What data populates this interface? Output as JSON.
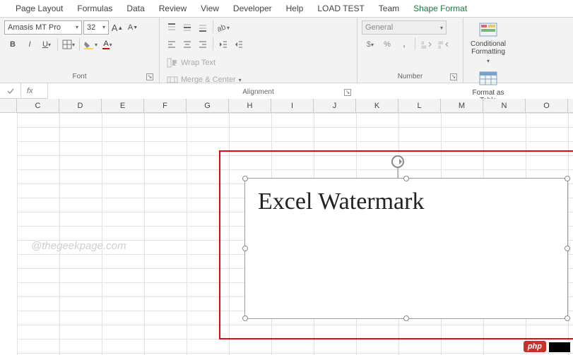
{
  "tabs": {
    "items": [
      "Page Layout",
      "Formulas",
      "Data",
      "Review",
      "View",
      "Developer",
      "Help",
      "LOAD TEST",
      "Team",
      "Shape Format"
    ],
    "active_index": 9
  },
  "ribbon": {
    "font": {
      "group_label": "Font",
      "font_name": "Amasis MT Pro",
      "font_size": "32",
      "grow_label": "A▲",
      "shrink_label": "A▼",
      "bold": "B",
      "italic": "I",
      "underline": "U",
      "fill_hint": "ab",
      "color_hint": "A"
    },
    "alignment": {
      "group_label": "Alignment",
      "wrap_label": "Wrap Text",
      "merge_label": "Merge & Center"
    },
    "number": {
      "group_label": "Number",
      "format": "General",
      "currency": "$",
      "percent": "%",
      "comma": ",",
      "inc": ".0→.00",
      "dec": ".00→.0"
    },
    "styles": {
      "cond_label": "Conditional Formatting",
      "table_label": "Format as Table"
    }
  },
  "formula_bar": {
    "fx": "fx",
    "value": ""
  },
  "columns": [
    "C",
    "D",
    "E",
    "F",
    "G",
    "H",
    "I",
    "J",
    "K",
    "L",
    "M",
    "N",
    "O"
  ],
  "shape": {
    "text": "Excel Watermark"
  },
  "page_watermark": "@thegeekpage.com",
  "badge": "php"
}
